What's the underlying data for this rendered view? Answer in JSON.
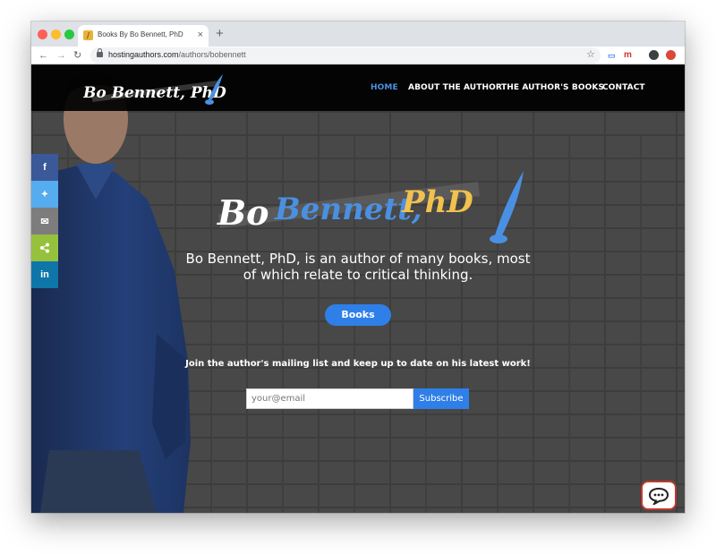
{
  "browser": {
    "tab_title": "Books By Bo Bennett, PhD",
    "tab_close": "×",
    "new_tab": "+",
    "url_host": "hostingauthors.com",
    "url_path": "/authors/bobennett",
    "back": "←",
    "forward": "→",
    "reload": "↻",
    "star": "☆",
    "ext_m": "m"
  },
  "header": {
    "logo_text": "Bo Bennett, PhD",
    "nav": [
      {
        "label": "HOME",
        "active": true
      },
      {
        "label": "ABOUT THE AUTHOR",
        "active": false
      },
      {
        "label": "THE AUTHOR'S BOOKS",
        "active": false
      },
      {
        "label": "CONTACT",
        "active": false
      }
    ]
  },
  "share": [
    {
      "icon": "facebook-icon",
      "glyph": "f",
      "color": "#3b5998"
    },
    {
      "icon": "twitter-icon",
      "glyph": "🐦",
      "color": "#55acee"
    },
    {
      "icon": "email-icon",
      "glyph": "✉",
      "color": "#7d7d7d"
    },
    {
      "icon": "share-icon",
      "glyph": "⋖",
      "color": "#95c13d"
    },
    {
      "icon": "linkedin-icon",
      "glyph": "in",
      "color": "#0e76a8"
    }
  ],
  "hero": {
    "logo_text": "Bo Bennett, PhD",
    "headline": "Bo Bennett, PhD, is an author of many books, most of which relate to critical thinking.",
    "books_button": "Books",
    "mailing_text": "Join the author's mailing list and keep up to date on his latest work!",
    "email_placeholder": "your@email",
    "subscribe_button": "Subscribe"
  },
  "colors": {
    "accent_blue": "#2f7fe8",
    "nav_active": "#4a90e2",
    "logo_yellow": "#f2c14e"
  }
}
